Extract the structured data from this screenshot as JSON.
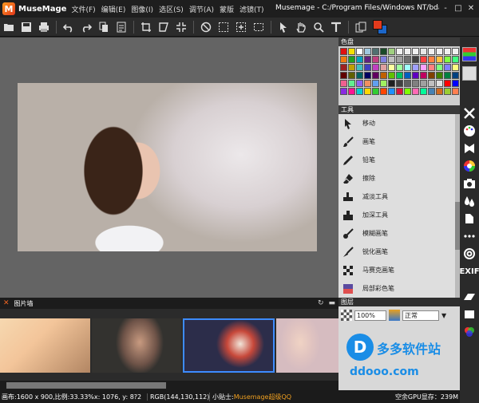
{
  "app": {
    "logo_letter": "M",
    "name": "MuseMage",
    "window_title": "Musemage - C:/Program Files/Windows NT/bda2ce3..."
  },
  "menu": [
    "文件(F)",
    "编辑(E)",
    "图像(I)",
    "选区(S)",
    "调节(A)",
    "蒙版",
    "滤镜(T)"
  ],
  "window_buttons": [
    "-",
    "□",
    "✕"
  ],
  "colors": {
    "foreground": "#e23a1c",
    "background": "#1c66c8",
    "accent": "#f06522",
    "selection": "#3d8cff"
  },
  "palette": {
    "title": "色盘",
    "swatches": [
      "#e01010",
      "#f5e100",
      "#ffffff",
      "#a0c8e0",
      "#507070",
      "#1a4a28",
      "#a0d080",
      "#f0f0f0",
      "#f0f0f0",
      "#f0f0f0",
      "#e8e8e8",
      "#f0f0f0",
      "#f0f0f0",
      "#f0f0f0",
      "#f0f0f0",
      "#f07a10",
      "#20a020",
      "#00a0c0",
      "#602080",
      "#c04080",
      "#8080e0",
      "#c0c0c0",
      "#a0a0a0",
      "#707070",
      "#404040",
      "#ff4040",
      "#ff8040",
      "#ffc040",
      "#80ff40",
      "#40ff80",
      "#a02020",
      "#c0a000",
      "#40c0c0",
      "#4040c0",
      "#c040c0",
      "#e0a0a0",
      "#ffffa0",
      "#a0ffa0",
      "#a0ffff",
      "#a0a0ff",
      "#ffa0ff",
      "#ff8080",
      "#80ff80",
      "#8080ff",
      "#ffff80",
      "#600000",
      "#606000",
      "#006060",
      "#000060",
      "#600060",
      "#c06000",
      "#60c000",
      "#00c060",
      "#0060c0",
      "#6000c0",
      "#c00060",
      "#804000",
      "#408000",
      "#008040",
      "#004080",
      "#f06090",
      "#60f090",
      "#9060f0",
      "#f09060",
      "#60a0f0",
      "#a0f060",
      "#202020",
      "#404040",
      "#606060",
      "#808080",
      "#a0a0a0",
      "#c0c0c0",
      "#e0e0e0",
      "#ff0000",
      "#0000ff",
      "#8a2be2",
      "#ff1493",
      "#00ced1",
      "#ffd700",
      "#32cd32",
      "#ff4500",
      "#1e90ff",
      "#dc143c",
      "#7fff00",
      "#ff69b4",
      "#00fa9a",
      "#4682b4",
      "#d2691e",
      "#9acd32",
      "#ff7f50"
    ]
  },
  "tools": {
    "title": "工具",
    "items": [
      {
        "label": "移动",
        "icon": "move-arrow-icon"
      },
      {
        "label": "画笔",
        "icon": "paintbrush-icon"
      },
      {
        "label": "铅笔",
        "icon": "pencil-icon"
      },
      {
        "label": "擦除",
        "icon": "eraser-icon"
      },
      {
        "label": "减淡工具",
        "icon": "dodge-icon"
      },
      {
        "label": "加深工具",
        "icon": "burn-icon"
      },
      {
        "label": "模糊画笔",
        "icon": "blur-brush-icon"
      },
      {
        "label": "锐化画笔",
        "icon": "sharpen-brush-icon"
      },
      {
        "label": "马赛克画笔",
        "icon": "mosaic-brush-icon"
      },
      {
        "label": "局部彩色笔",
        "icon": "local-color-brush-icon"
      }
    ]
  },
  "photo_wall": {
    "close": "✕",
    "title": "图片墙"
  },
  "layers": {
    "title": "图层",
    "opacity": "100%",
    "blend_mode": "正常"
  },
  "side_icons": [
    "fx-icon",
    "palette-icon",
    "crop-icon",
    "color-wheel-icon",
    "camera-icon",
    "drops-icon",
    "clone-icon",
    "dots-icon",
    "at-icon"
  ],
  "side_exif": "EXIF",
  "watermark": {
    "logo": "D",
    "name": "多多软件站",
    "url": "ddooo.com"
  },
  "status": {
    "canvas_info": "画布:1600 x 900,比例:33.33%x: 1076, y: 8?2",
    "rgb": "RGB(144,130,112)",
    "tip_prefix": "小贴士:",
    "tip": "Musemage超级QQ",
    "gpu": "空余GPU显存：239M"
  }
}
